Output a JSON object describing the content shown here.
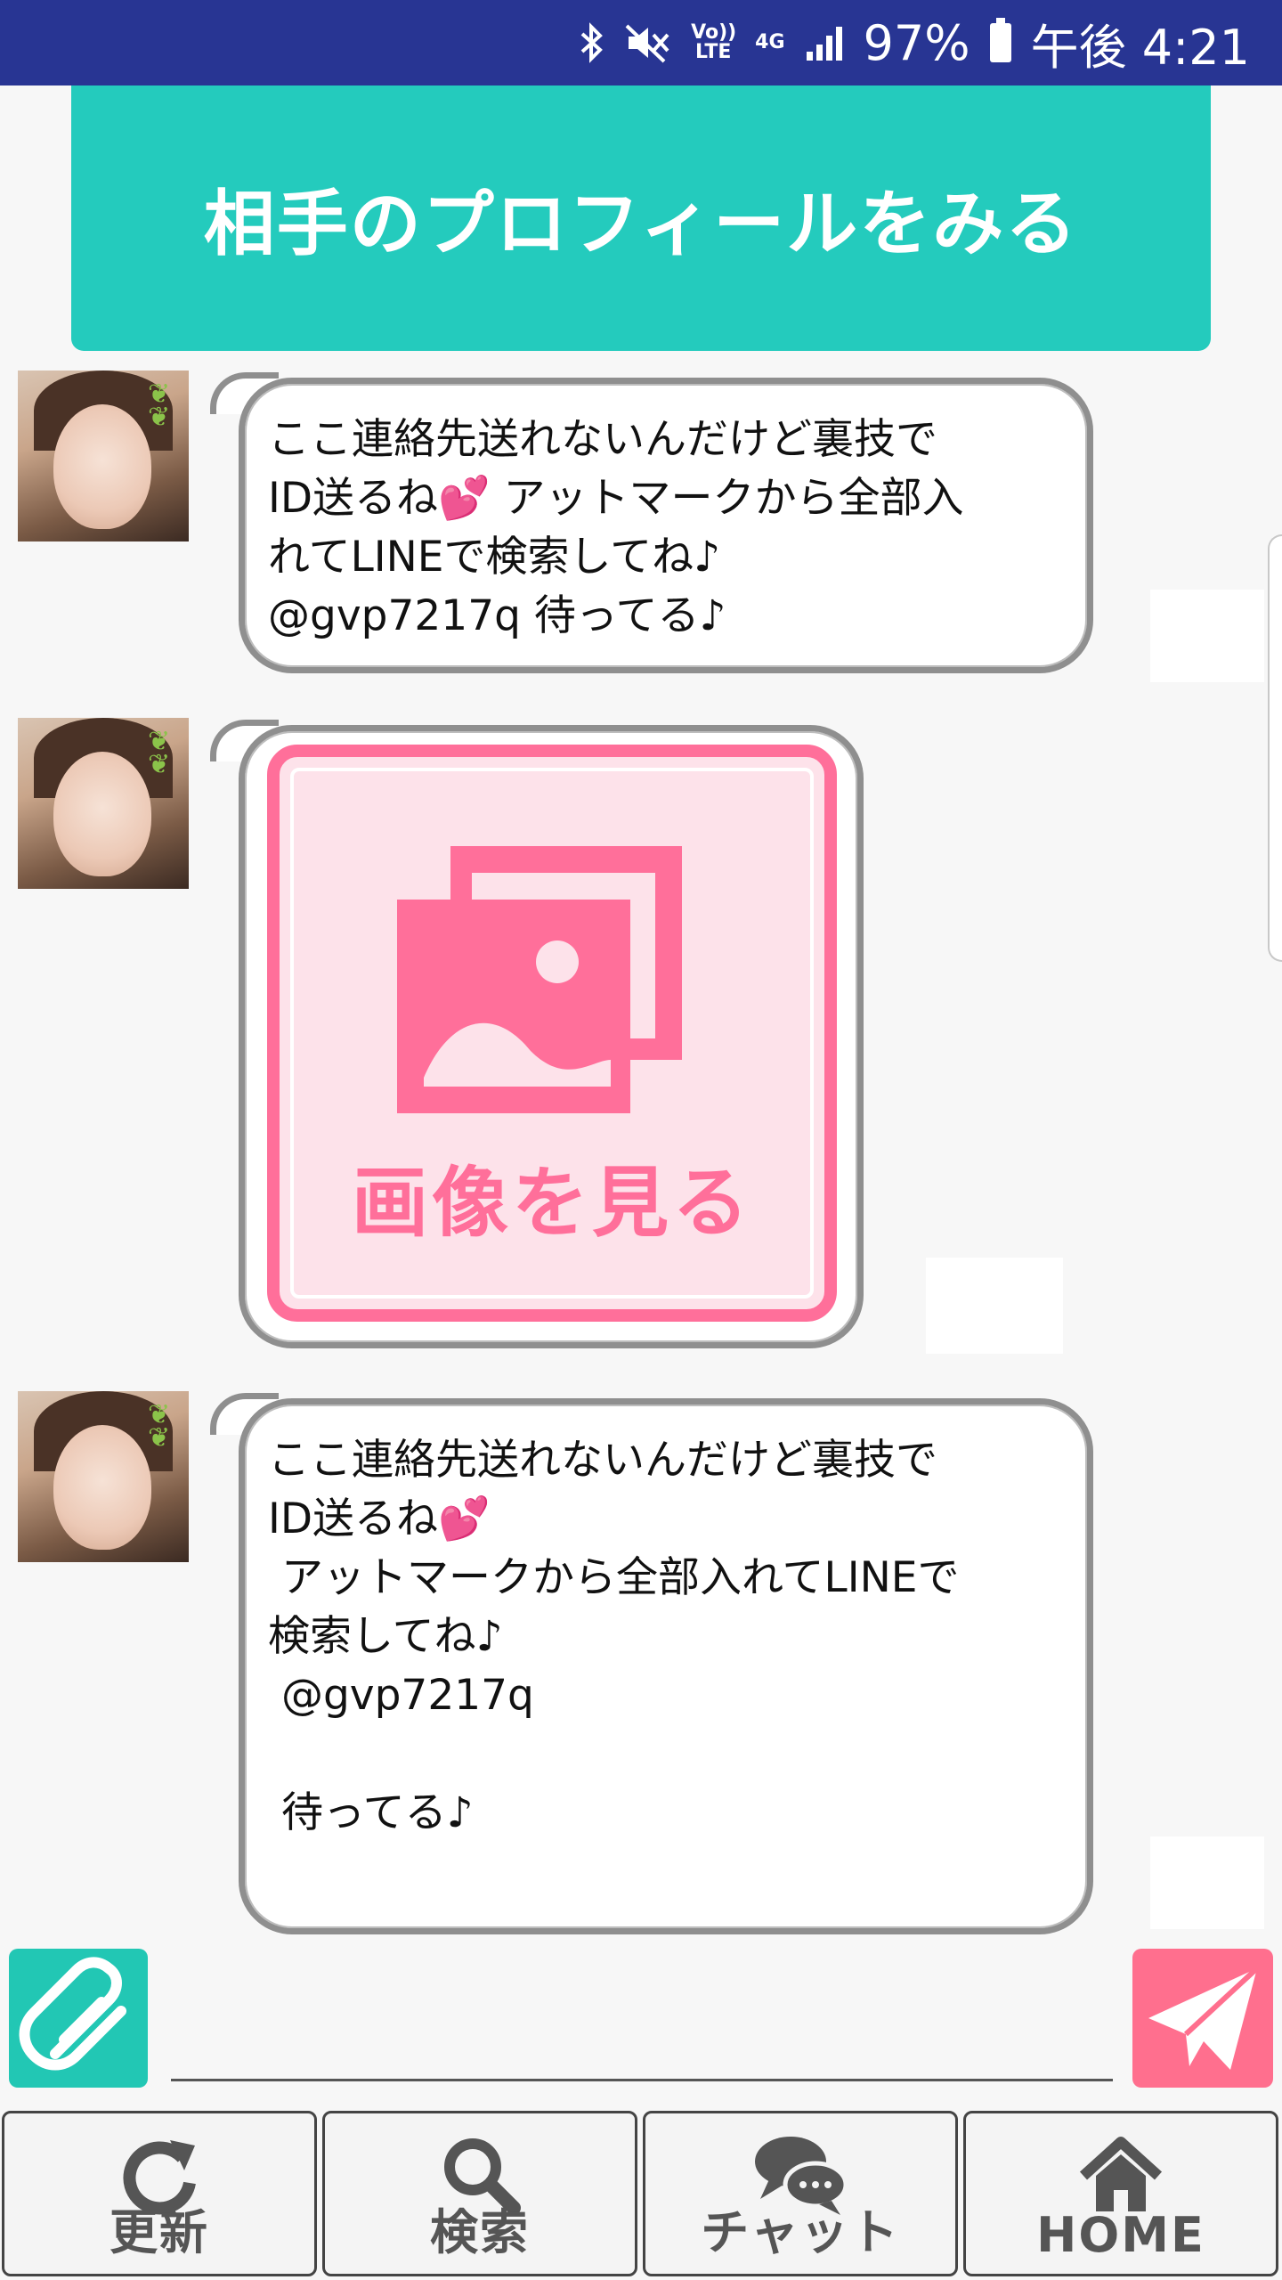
{
  "status_bar": {
    "icons": [
      "bluetooth-icon",
      "mute-icon",
      "volte-icon",
      "4g-icon",
      "signal-icon",
      "battery-icon"
    ],
    "volte_label": "Vo)) LTE",
    "network_label": "4G",
    "battery": "97%",
    "time": "午後 4:21"
  },
  "profile_button": {
    "label": "相手のプロフィールをみる"
  },
  "messages": [
    {
      "text": "ここ連絡先送れないんだけど裏技で\nID送るね💕 アットマークから全部入\nれてLINEで検索してね♪\n@gvp7217q 待ってる♪"
    },
    {
      "image_label": "画像を見る"
    },
    {
      "text": "ここ連絡先送れないんだけど裏技で\nID送るね💕\n アットマークから全部入れてLINEで\n検索してね♪\n @gvp7217q\n\n 待ってる♪"
    }
  ],
  "input": {
    "placeholder": ""
  },
  "bottom_nav": [
    {
      "label": "更新",
      "icon": "refresh-icon"
    },
    {
      "label": "検索",
      "icon": "search-icon"
    },
    {
      "label": "チャット",
      "icon": "chat-icon"
    },
    {
      "label": "HOME",
      "icon": "home-icon"
    }
  ],
  "colors": {
    "status_bar": "#283593",
    "teal": "#24cbbd",
    "pink": "#ff6f9a",
    "send_pink": "#ff6f8e"
  }
}
